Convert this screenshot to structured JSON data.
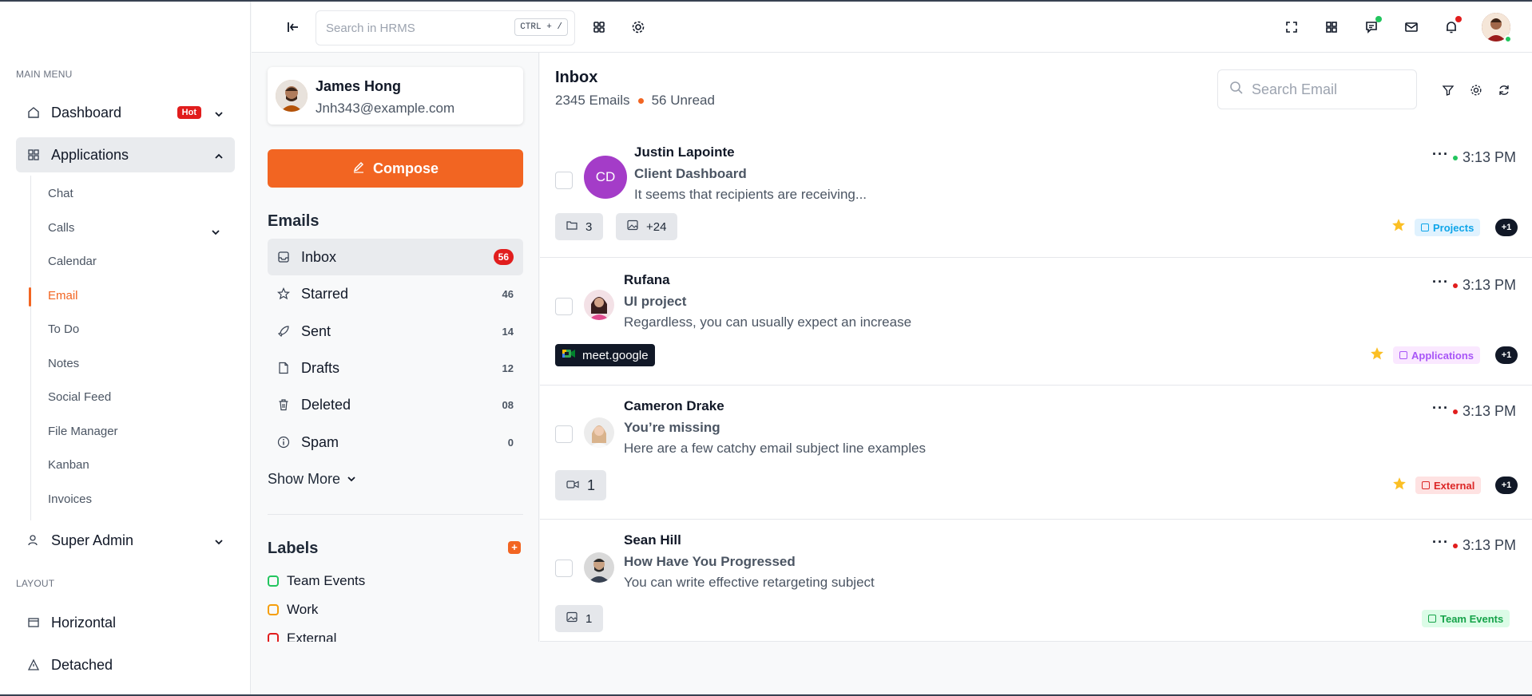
{
  "sidebar": {
    "main_menu": "MAIN MENU",
    "dashboard": "Dashboard",
    "hot": "Hot",
    "applications": "Applications",
    "sub": [
      "Chat",
      "Calls",
      "Calendar",
      "Email",
      "To Do",
      "Notes",
      "Social Feed",
      "File Manager",
      "Kanban",
      "Invoices"
    ],
    "super_admin": "Super Admin",
    "layout": "LAYOUT",
    "horizontal": "Horizontal",
    "detached": "Detached"
  },
  "header": {
    "search_placeholder": "Search in HRMS",
    "shortcut": "CTRL + /"
  },
  "colors": {
    "accent": "#f26522",
    "red": "#e11d1d",
    "green": "#22c55e"
  },
  "mail_left": {
    "name": "James Hong",
    "email": "Jnh343@example.com",
    "compose": "Compose",
    "emails_title": "Emails",
    "folders": [
      {
        "label": "Inbox",
        "count": "56"
      },
      {
        "label": "Starred",
        "count": "46"
      },
      {
        "label": "Sent",
        "count": "14"
      },
      {
        "label": "Drafts",
        "count": "12"
      },
      {
        "label": "Deleted",
        "count": "08"
      },
      {
        "label": "Spam",
        "count": "0"
      }
    ],
    "show_more": "Show More",
    "labels_title": "Labels",
    "labels": [
      "Team Events",
      "Work",
      "External"
    ]
  },
  "inbox": {
    "title": "Inbox",
    "emails_count": "2345 Emails",
    "unread": "56 Unread",
    "search_placeholder": "Search Email",
    "rows": [
      {
        "initials": "CD",
        "sender": "Justin Lapointe",
        "subject": "Client Dashboard",
        "snippet": "It seems that recipients are receiving...",
        "time": "3:13 PM",
        "chip1": "3",
        "chip2": "+24",
        "tag": "Projects",
        "plus": "+1"
      },
      {
        "sender": "Rufana",
        "subject": "UI project",
        "snippet": "Regardless, you can usually expect an increase",
        "time": "3:13 PM",
        "meet": "meet.google",
        "tag": "Applications",
        "plus": "+1"
      },
      {
        "sender": "Cameron Drake",
        "subject": "You’re missing",
        "snippet": "Here are a few catchy email subject line examples",
        "time": "3:13 PM",
        "chip1": "1",
        "tag": "External",
        "plus": "+1"
      },
      {
        "sender": "Sean Hill",
        "subject": "How Have You Progressed",
        "snippet": "You can write effective retargeting subject",
        "time": "3:13 PM",
        "chip1": "1",
        "tag": "Team Events"
      }
    ]
  }
}
